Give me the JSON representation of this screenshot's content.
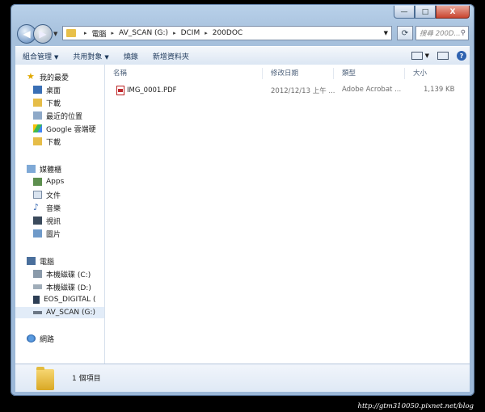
{
  "window": {
    "minimize_glyph": "—",
    "maximize_glyph": "□",
    "close_glyph": "X"
  },
  "address": {
    "segments": [
      "電腦",
      "AV_SCAN (G:)",
      "DCIM",
      "200DOC"
    ],
    "separator": "▸",
    "search_placeholder": "搜尋 200D..."
  },
  "toolbar": {
    "organize": "組合管理",
    "share": "共用對象",
    "burn": "燒錄",
    "new_folder": "新增資料夾"
  },
  "sidebar": {
    "favorites": {
      "label": "我的最愛",
      "items": [
        "桌面",
        "下載",
        "最近的位置",
        "Google 雲端硬",
        "下載"
      ]
    },
    "libraries": {
      "label": "媒體櫃",
      "items": [
        "Apps",
        "文件",
        "音樂",
        "視訊",
        "圖片"
      ]
    },
    "computer": {
      "label": "電腦",
      "items": [
        "本機磁碟 (C:)",
        "本機磁碟 (D:)",
        "EOS_DIGITAL (",
        "AV_SCAN (G:)"
      ]
    },
    "network": {
      "label": "網路"
    }
  },
  "columns": {
    "name": "名稱",
    "modified": "修改日期",
    "type": "類型",
    "size": "大小"
  },
  "files": [
    {
      "name": "IMG_0001.PDF",
      "modified": "2012/12/13 上午 ...",
      "type": "Adobe Acrobat ...",
      "size": "1,139 KB"
    }
  ],
  "status": {
    "count": "1 個項目"
  },
  "watermark": "http://gtm310050.pixnet.net/blog",
  "colors": {
    "selection": "#e2ecf8",
    "frame": "#b9d1ea",
    "pdf_red": "#c0282d"
  }
}
